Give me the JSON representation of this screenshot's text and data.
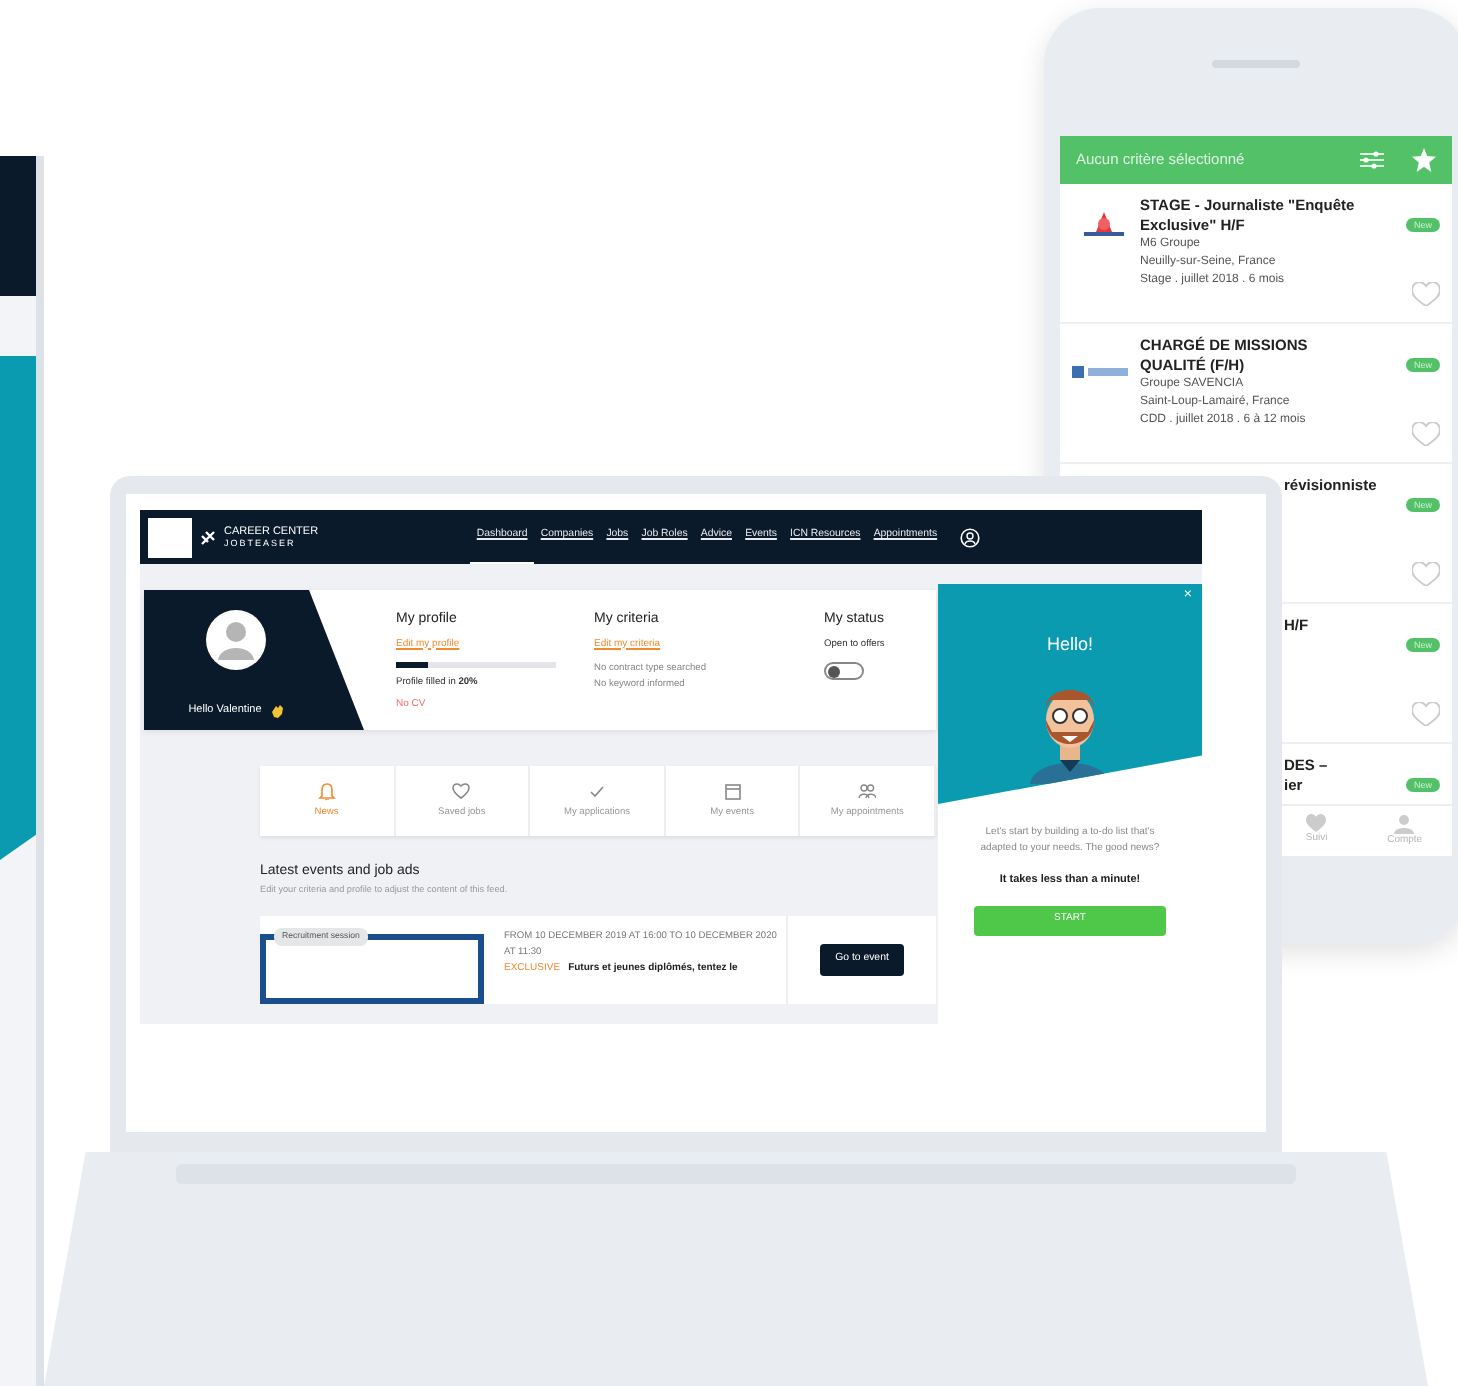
{
  "phone": {
    "filter_bar": {
      "text": "Aucun critère sélectionné"
    },
    "jobs": [
      {
        "kind": "full",
        "title": "STAGE - Journaliste \"Enquête Exclusive\" H/F",
        "company": "M6 Groupe",
        "location": "Neuilly-sur-Seine, France",
        "details": "Stage . juillet 2018 . 6 mois",
        "badge": "New"
      },
      {
        "kind": "full",
        "title": "CHARGÉ DE MISSIONS QUALITÉ (F/H)",
        "company": "Groupe SAVENCIA",
        "location": "Saint-Loup-Lamairé, France",
        "details": "CDD . juillet 2018 . 6 à 12 mois",
        "badge": "New"
      },
      {
        "kind": "partial",
        "title": "révisionniste",
        "badge": "New"
      },
      {
        "kind": "partial",
        "title": "H/F",
        "badge": "New"
      },
      {
        "kind": "partial",
        "title": "DES –",
        "subtitle": "ier",
        "badge": "New"
      }
    ],
    "tab_bar": [
      {
        "label": "Suivi"
      },
      {
        "label": "Compte"
      }
    ]
  },
  "laptop": {
    "navbar": {
      "brand": "CAREER CENTER",
      "brand_sub": "JOBTEASER",
      "links": [
        {
          "label": "Dashboard",
          "selected": true
        },
        {
          "label": "Companies",
          "selected": false
        },
        {
          "label": "Jobs",
          "selected": false
        },
        {
          "label": "Job Roles",
          "selected": false
        },
        {
          "label": "Advice",
          "selected": false
        },
        {
          "label": "Events",
          "selected": false
        },
        {
          "label": "ICN Resources",
          "selected": false
        },
        {
          "label": "Appointments",
          "selected": false
        }
      ]
    },
    "profile": {
      "greeting": "Hello Valentine",
      "my_profile": {
        "title": "My profile",
        "link": "Edit my profile",
        "level": 0.2,
        "filled": "Profile filled in **20%**",
        "cv": "No CV"
      },
      "my_criteria": {
        "title": "My criteria",
        "link": "Edit my criteria",
        "lines": [
          "No contract type searched",
          "No keyword informed"
        ]
      },
      "my_status": {
        "title": "My status",
        "label": "Open to offers",
        "on": false
      }
    },
    "tabs": [
      {
        "label": "News",
        "selected": true
      },
      {
        "label": "Saved jobs",
        "selected": false
      },
      {
        "label": "My applications",
        "selected": false
      },
      {
        "label": "My events",
        "selected": false
      },
      {
        "label": "My appointments",
        "selected": false
      }
    ],
    "feed": {
      "title": "Latest events and job ads",
      "subtitle": "Edit your criteria and profile to adjust the content of this feed.",
      "event": {
        "tag": "Recruitment session",
        "date": "FROM 10 DECEMBER 2019 AT 16:00 TO 10 DECEMBER 2020 AT 11:30",
        "label": "EXCLUSIVE",
        "title": "Futurs et jeunes diplômés, tentez le",
        "button": "Go to event"
      }
    },
    "hello_panel": {
      "close": "×",
      "title": "Hello!",
      "message": "Let's start by building a to-do list that's adapted to your needs. The good news?",
      "emphasis": "It takes less than a minute!",
      "button": "START"
    }
  }
}
